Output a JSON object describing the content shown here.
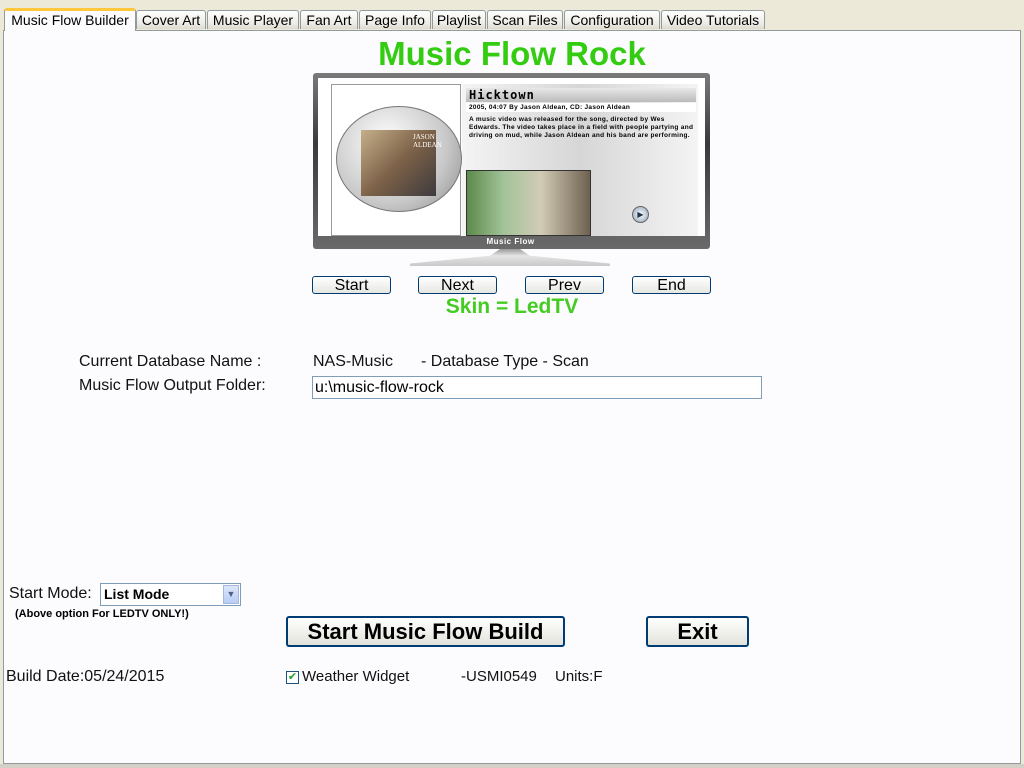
{
  "tabs": [
    {
      "label": "Music Flow Builder",
      "active": true
    },
    {
      "label": "Cover Art"
    },
    {
      "label": "Music Player"
    },
    {
      "label": "Fan Art"
    },
    {
      "label": "Page Info"
    },
    {
      "label": "Playlist"
    },
    {
      "label": "Scan Files"
    },
    {
      "label": "Configuration"
    },
    {
      "label": "Video Tutorials"
    }
  ],
  "main": {
    "title": "Music Flow Rock",
    "skin_text": "Skin = LedTV",
    "preview": {
      "cover_text": "JASON ALDEAN",
      "song_title": "Hicktown",
      "song_meta": "2005, 04:07 By Jason Aldean, CD: Jason Aldean",
      "song_desc": "A music video was released for the song, directed by Wes Edwards. The video takes place in a field with people partying and driving on mud, while Jason Aldean and his band are performing.",
      "brand": "Music Flow"
    },
    "nav": {
      "start": "Start",
      "next": "Next",
      "prev": "Prev",
      "end": "End"
    },
    "db_label": "Current Database Name :",
    "db_name": "NAS-Music",
    "db_type": "- Database Type - Scan",
    "output_label": "Music Flow Output Folder:",
    "output_value": "u:\\music-flow-rock",
    "start_mode_label": "Start Mode:",
    "start_mode_value": "List Mode",
    "start_mode_note": "(Above option For LEDTV ONLY!)",
    "build_button": "Start Music Flow Build",
    "exit_button": "Exit",
    "build_date": "Build Date:05/24/2015",
    "weather_label": "Weather Widget",
    "weather_checked": true,
    "weather_code": "-USMI0549",
    "units": "Units:F"
  },
  "colors": {
    "title": "#33cc11",
    "skin": "#44cc22",
    "tab_highlight": "#ffc83c",
    "panel_bg": "#fcfcfe",
    "window_bg": "#ece9d8"
  }
}
